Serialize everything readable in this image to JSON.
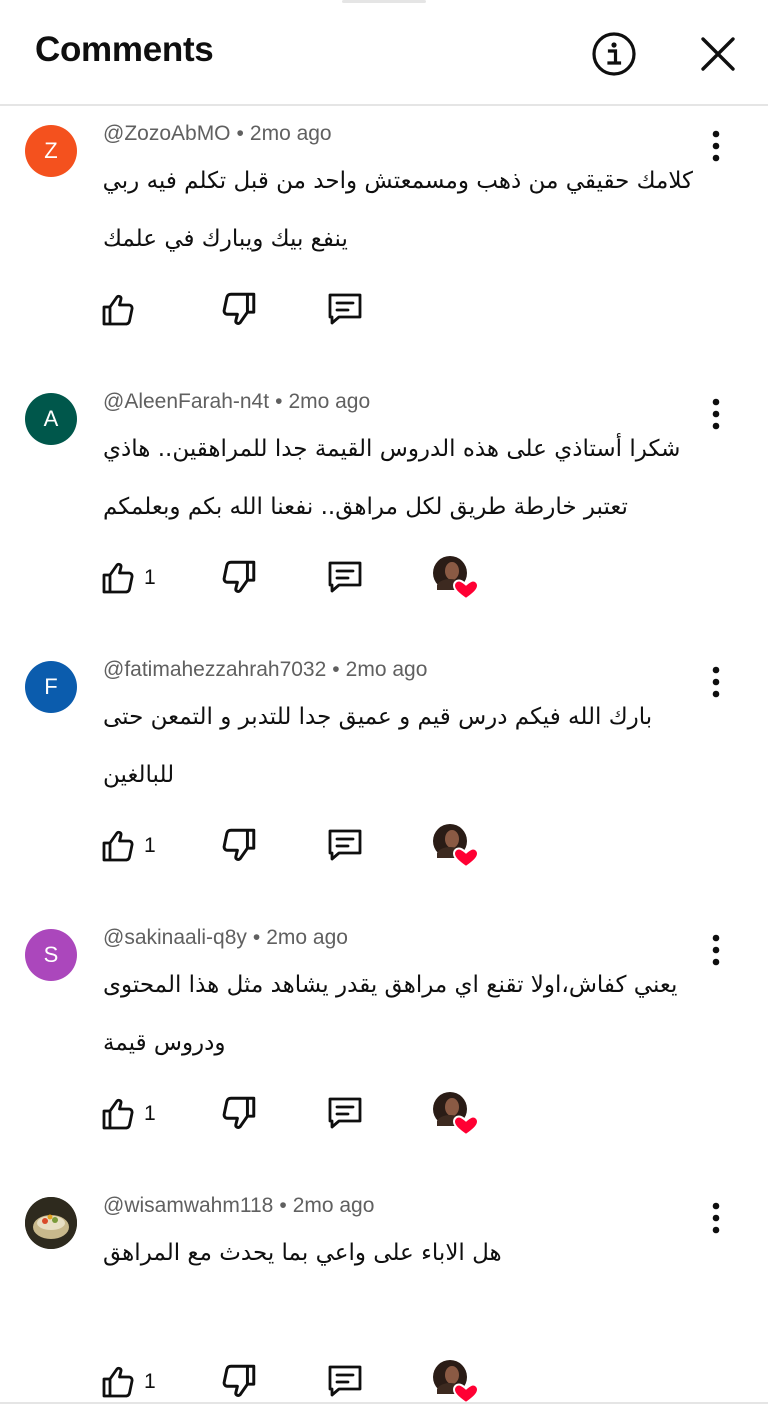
{
  "header": {
    "title": "Comments"
  },
  "comments": [
    {
      "avatar_letter": "Z",
      "avatar_color": "#f4511e",
      "author": "@ZozoAbMO",
      "time": "2mo ago",
      "lines": [
        "كلامك حقيقي من ذهب ومسمعتش واحد من قبل تكلم فيه ربي",
        "ينفع بيك ويبارك في علمك"
      ],
      "likes": "",
      "hearted": false
    },
    {
      "avatar_letter": "A",
      "avatar_color": "#00574b",
      "author": "@AleenFarah-n4t",
      "time": "2mo ago",
      "lines": [
        "شكرا أستاذي على هذه الدروس القيمة جدا للمراهقين.. هاذي",
        "تعتبر خارطة طريق لكل مراهق.. نفعنا الله بكم وبعلمكم"
      ],
      "likes": "1",
      "hearted": true
    },
    {
      "avatar_letter": "F",
      "avatar_color": "#0b5cad",
      "author": "@fatimahezzahrah7032",
      "time": "2mo ago",
      "lines": [
        "بارك الله فيكم درس قيم و عميق جدا للتدبر و التمعن حتى",
        "للبالغين"
      ],
      "likes": "1",
      "hearted": true
    },
    {
      "avatar_letter": "S",
      "avatar_color": "#ab47bc",
      "author": "@sakinaali-q8y",
      "time": "2mo ago",
      "lines": [
        "يعني كفاش،اولا تقنع اي مراهق يقدر يشاهد مثل هذا المحتوى",
        "ودروس قيمة"
      ],
      "likes": "1",
      "hearted": true
    },
    {
      "avatar_letter": "",
      "avatar_color": "#3a3a2a",
      "author": "@wisamwahm118",
      "time": "2mo ago",
      "lines": [
        "هل الاباء على واعي بما يحدث مع المراهق"
      ],
      "likes": "1",
      "hearted": true
    }
  ],
  "colors": {
    "meta": "#606060",
    "heart": "#ff0033",
    "divider": "#e5e5e5"
  },
  "icons": [
    "info-icon",
    "close-icon",
    "more-vert-icon",
    "thumb-up-icon",
    "thumb-down-icon",
    "reply-icon",
    "creator-heart-icon"
  ]
}
